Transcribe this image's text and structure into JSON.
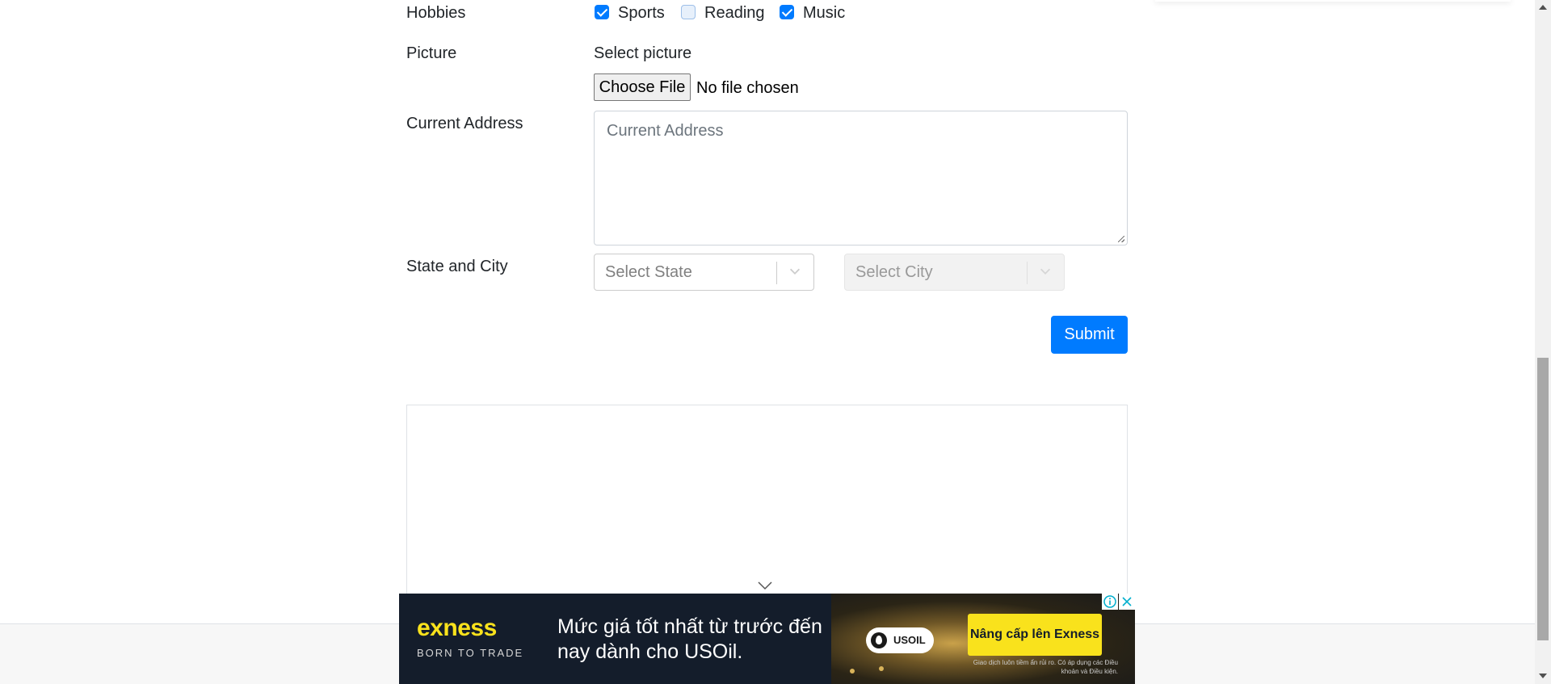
{
  "form": {
    "hobbies_label": "Hobbies",
    "hobbies": [
      {
        "label": "Sports",
        "checked": true
      },
      {
        "label": "Reading",
        "checked": false
      },
      {
        "label": "Music",
        "checked": true
      }
    ],
    "picture_label": "Picture",
    "picture_prompt": "Select picture",
    "choose_file_label": "Choose File",
    "file_status": "No file chosen",
    "address_label": "Current Address",
    "address_placeholder": "Current Address",
    "address_value": "",
    "state_city_label": "State and City",
    "state_placeholder": "Select State",
    "city_placeholder": "Select City",
    "submit_label": "Submit"
  },
  "ad": {
    "brand": "exness",
    "tagline": "BORN TO TRADE",
    "headline": "Mức giá tốt nhất từ trước đến nay dành cho USOil.",
    "badge": "USOIL",
    "cta": "Nâng cấp lên Exness",
    "disclaimer": "Giao dịch luôn tiềm ẩn rủi ro. Có áp dụng các Điều khoản và Điều kiện.",
    "brand_color": "#f9e21c",
    "background_color": "#141d2b"
  },
  "colors": {
    "primary": "#007bff",
    "text": "#212529",
    "placeholder": "#6c757d"
  }
}
